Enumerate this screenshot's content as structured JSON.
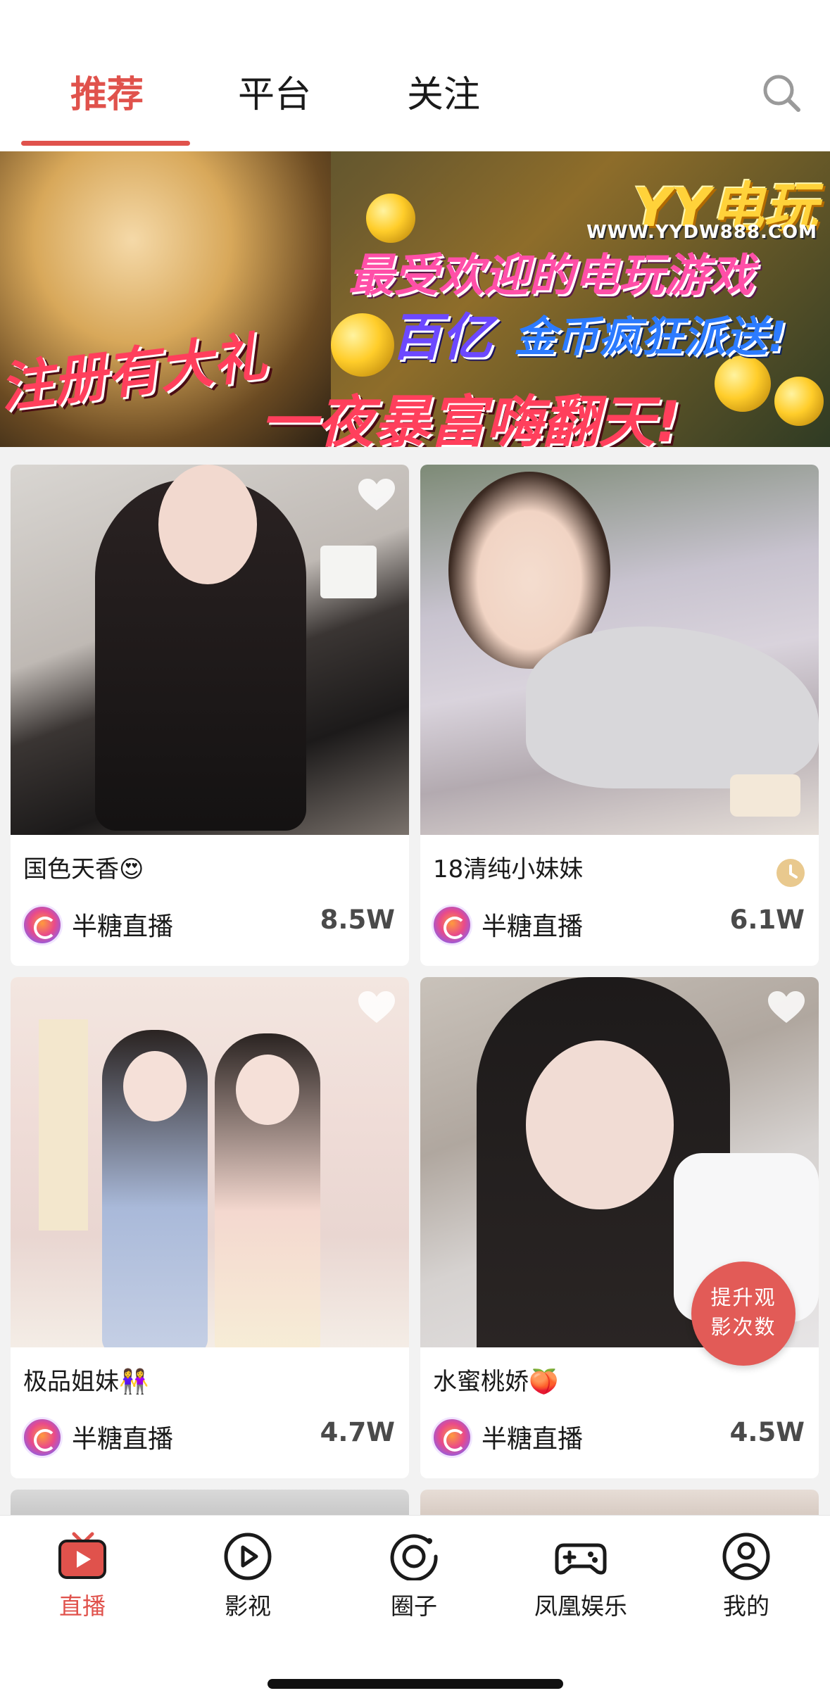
{
  "header": {
    "tabs": [
      {
        "label": "推荐",
        "active": true
      },
      {
        "label": "平台",
        "active": false
      },
      {
        "label": "关注",
        "active": false
      }
    ],
    "search_icon": "search-icon",
    "accent_color": "#e0524c"
  },
  "banner": {
    "brand": "YY电玩",
    "url": "WWW.YYDW888.COM",
    "line1": "最受欢迎的电玩游戏",
    "line2a": "百亿",
    "line2b": "金币疯狂派送!",
    "line3": "注册有大礼",
    "line4": "一夜暴富嗨翻天!"
  },
  "cards": [
    {
      "title": "国色天香😍",
      "platform": "半糖直播",
      "count": "8.5W",
      "badge": "heart-icon"
    },
    {
      "title": "18清纯小妹妹",
      "platform": "半糖直播",
      "count": "6.1W",
      "badge": "clock-icon"
    },
    {
      "title": "极品姐妹👭",
      "platform": "半糖直播",
      "count": "4.7W",
      "badge": "heart-icon"
    },
    {
      "title": "水蜜桃娇🍑",
      "platform": "半糖直播",
      "count": "4.5W",
      "badge": "heart-icon"
    }
  ],
  "fab": {
    "line1": "提升观",
    "line2": "影次数"
  },
  "tabbar": {
    "items": [
      {
        "label": "直播",
        "icon": "tv-icon",
        "active": true
      },
      {
        "label": "影视",
        "icon": "play-icon",
        "active": false
      },
      {
        "label": "圈子",
        "icon": "circle-icon",
        "active": false
      },
      {
        "label": "凤凰娱乐",
        "icon": "gamepad-icon",
        "active": false
      },
      {
        "label": "我的",
        "icon": "user-icon",
        "active": false
      }
    ]
  }
}
